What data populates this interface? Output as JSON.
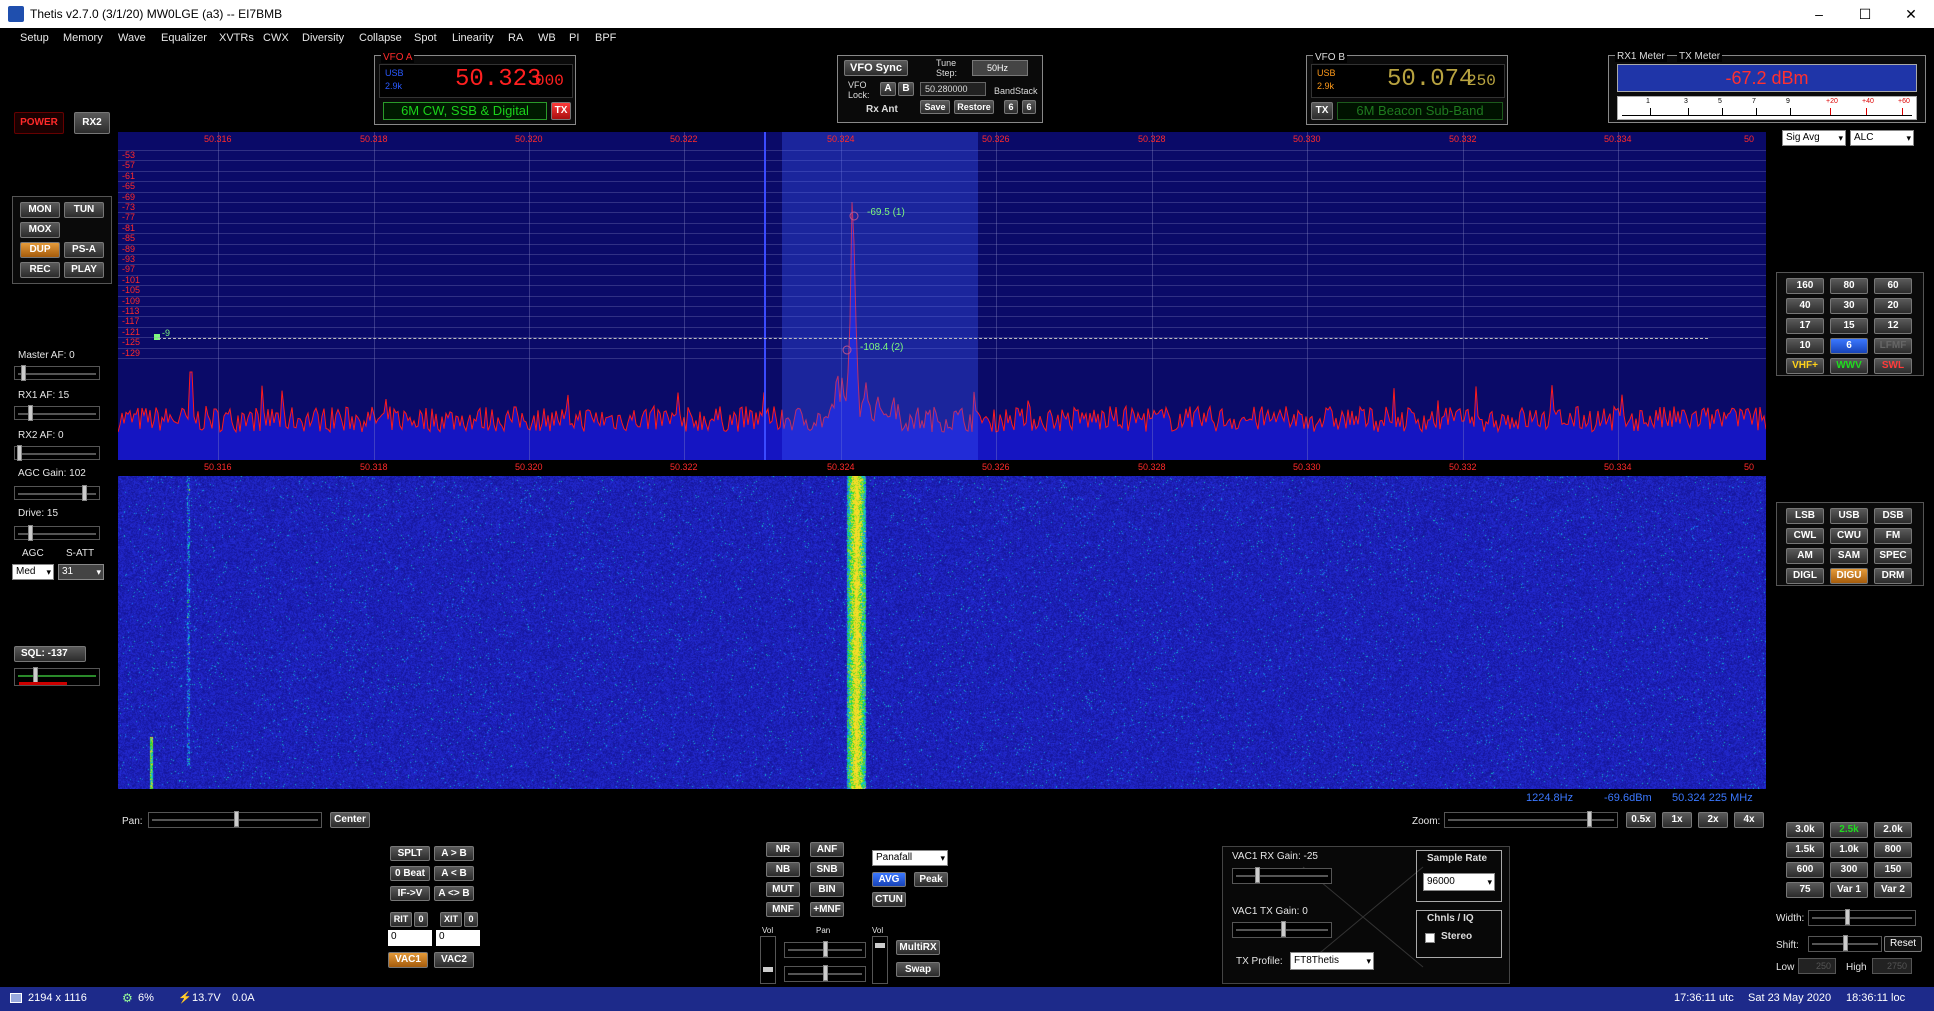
{
  "window": {
    "title": "Thetis v2.7.0 (3/1/20) MW0LGE (a3)   --   EI7BMB",
    "minimize": "–",
    "maximize": "☐",
    "close": "✕"
  },
  "menu": [
    "Setup",
    "Memory",
    "Wave",
    "Equalizer",
    "XVTRs",
    "CWX",
    "Diversity",
    "Collapse",
    "Spot",
    "Linearity",
    "RA",
    "WB",
    "PI",
    "BPF"
  ],
  "left": {
    "power": "POWER",
    "rx2": "RX2",
    "mon": "MON",
    "tun": "TUN",
    "mox": "MOX",
    "dup": "DUP",
    "psa": "PS-A",
    "rec": "REC",
    "play": "PLAY",
    "master_af": "Master AF:  0",
    "rx1_af": "RX1 AF:  15",
    "rx2_af": "RX2 AF:  0",
    "agc_gain": "AGC Gain:  102",
    "drive": "Drive:  15",
    "agc": "AGC",
    "satt": "S-ATT",
    "agc_value": "Med",
    "satt_value": "31",
    "sql": "SQL: -137",
    "master_af_level": 0.05,
    "rx1_af_level": 0.15,
    "rx2_af_level": 0.0,
    "agc_gain_level": 0.85,
    "drive_level": 0.15
  },
  "vfo_a": {
    "label": "VFO A",
    "mode_small": "USB",
    "bw_small": "2.9k",
    "freq_main": "50.323",
    "freq_sub": "000",
    "band_text": "6M CW, SSB & Digital",
    "tx": "TX"
  },
  "vfo_center": {
    "sync": "VFO Sync",
    "tune_step_label": "Tune\nStep:",
    "tune_step_value": "50Hz",
    "vfo_lock": "VFO\nLock:",
    "lock_a": "A",
    "lock_b": "B",
    "lock_freq": "50.280000",
    "bandstack": "BandStack",
    "rx_ant": "Rx Ant",
    "save": "Save",
    "restore": "Restore",
    "bs1": "6",
    "bs2": "6"
  },
  "vfo_b": {
    "label": "VFO B",
    "mode_small": "USB",
    "bw_small": "2.9k",
    "freq_main": "50.074",
    "freq_sub": "250",
    "band_text": "6M Beacon Sub-Band",
    "tx": "TX"
  },
  "meter": {
    "rx1": "RX1 Meter",
    "tx": "TX Meter",
    "value": "-67.2 dBm",
    "scale": [
      "1",
      "3",
      "5",
      "7",
      "9",
      "+20",
      "+40",
      "+60"
    ],
    "sig_mode": "Sig Avg",
    "tx_mode": "ALC"
  },
  "spectrum": {
    "top_db": "60",
    "freq_labels": [
      "50.316",
      "50.318",
      "50.320",
      "50.322",
      "50.324",
      "50.326",
      "50.328",
      "50.330",
      "50.332",
      "50.334",
      "50"
    ],
    "db_labels": [
      "-53",
      "-57",
      "-61",
      "-65",
      "-69",
      "-73",
      "-77",
      "-81",
      "-85",
      "-89",
      "-93",
      "-97",
      "-101",
      "-105",
      "-109",
      "-113",
      "-117",
      "-121",
      "-125",
      "-129"
    ],
    "marker1": "-69.5 (1)",
    "marker2": "-108.4 (2)",
    "marker_sql": "-9",
    "readout_hz": "1224.8Hz",
    "readout_dbm": "-69.6dBm",
    "readout_mhz": "50.324 225 MHz"
  },
  "bands": [
    "160",
    "80",
    "60",
    "40",
    "30",
    "20",
    "17",
    "15",
    "12",
    "10",
    "6",
    "LFMF",
    "VHF+",
    "WWV",
    "SWL"
  ],
  "modes": [
    "LSB",
    "USB",
    "DSB",
    "CWL",
    "CWU",
    "FM",
    "AM",
    "SAM",
    "SPEC",
    "DIGL",
    "DIGU",
    "DRM"
  ],
  "filters": [
    "3.0k",
    "2.5k",
    "2.0k",
    "1.5k",
    "1.0k",
    "800",
    "600",
    "300",
    "150",
    "75",
    "Var 1",
    "Var 2"
  ],
  "filter_ctl": {
    "width": "Width:",
    "shift": "Shift:",
    "reset": "Reset",
    "low": "Low",
    "high": "High",
    "low_val": "250",
    "high_val": "2750"
  },
  "pan_zoom": {
    "pan": "Pan:",
    "center": "Center",
    "zoom": "Zoom:",
    "z05": "0.5x",
    "z1": "1x",
    "z2": "2x",
    "z4": "4x"
  },
  "bottom_left": {
    "splt": "SPLT",
    "atob": "A > B",
    "zerobeat": "0 Beat",
    "btoa": "A < B",
    "ifv": "IF->V",
    "swap_ab": "A <> B",
    "rit": "RIT",
    "rit_val": "0",
    "xit": "XIT",
    "xit_val": "0",
    "rit_spin": "0",
    "xit_spin": "0",
    "vac1": "VAC1",
    "vac2": "VAC2"
  },
  "dsp": {
    "nr": "NR",
    "anf": "ANF",
    "nb": "NB",
    "snb": "SNB",
    "mut": "MUT",
    "bin": "BIN",
    "mnf": "MNF",
    "plus_mnf": "+MNF",
    "display_mode": "Panafall",
    "avg": "AVG",
    "peak": "Peak",
    "ctun": "CTUN",
    "vol": "Vol",
    "pan": "Pan",
    "vol2": "Vol",
    "multirx": "MultiRX",
    "swap": "Swap"
  },
  "vac": {
    "rx_gain": "VAC1 RX Gain:  -25",
    "tx_gain": "VAC1 TX Gain:  0",
    "sample_rate": "Sample Rate",
    "rate_value": "96000",
    "chnls": "Chnls / IQ",
    "stereo": "Stereo",
    "tx_profile": "TX Profile:",
    "profile_value": "FT8Thetis"
  },
  "status": {
    "res": "2194 x 1116",
    "cpu": "6%",
    "volt": "13.7V",
    "amp": "0.0A",
    "utc": "17:36:11 utc",
    "date": "Sat 23 May 2020",
    "loc": "18:36:11 loc"
  }
}
